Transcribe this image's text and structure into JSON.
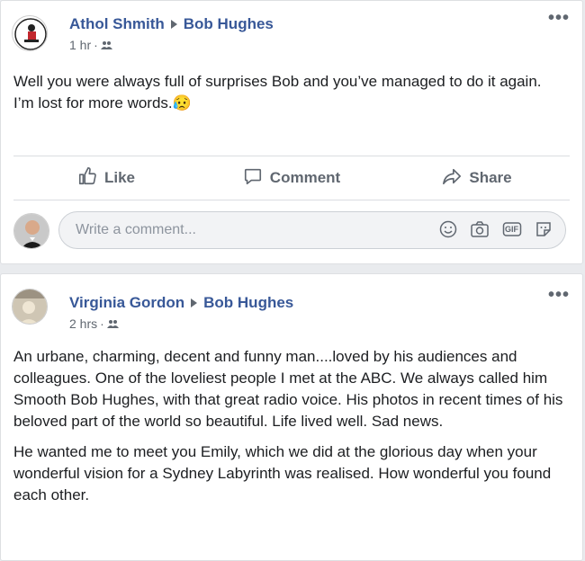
{
  "post1": {
    "author": "Athol Shmith",
    "target": "Bob Hughes",
    "time": "1 hr",
    "text_lines": [
      "Well you were always full of surprises Bob and you’ve managed to do it again.",
      "I’m lost for more words.😥"
    ],
    "actions": {
      "like": "Like",
      "comment": "Comment",
      "share": "Share"
    },
    "comment_placeholder": "Write a comment...",
    "gif_label": "GIF"
  },
  "post2": {
    "author": "Virginia Gordon",
    "target": "Bob Hughes",
    "time": "2 hrs",
    "paragraphs": [
      "An urbane, charming, decent and funny man....loved by his audiences and colleagues. One of the loveliest people I met at the ABC. We always called him Smooth Bob Hughes, with that great radio voice. His photos in recent times of his beloved part of the world so beautiful. Life lived well. Sad news.",
      "He wanted me to meet you Emily, which we did at the glorious day when your wonderful vision for a Sydney Labyrinth was realised. How wonderful you found each other."
    ]
  },
  "common": {
    "more_options": "•••",
    "separator": "·"
  },
  "colors": {
    "link": "#385898",
    "muted": "#606770",
    "bg": "#e9ebee"
  }
}
